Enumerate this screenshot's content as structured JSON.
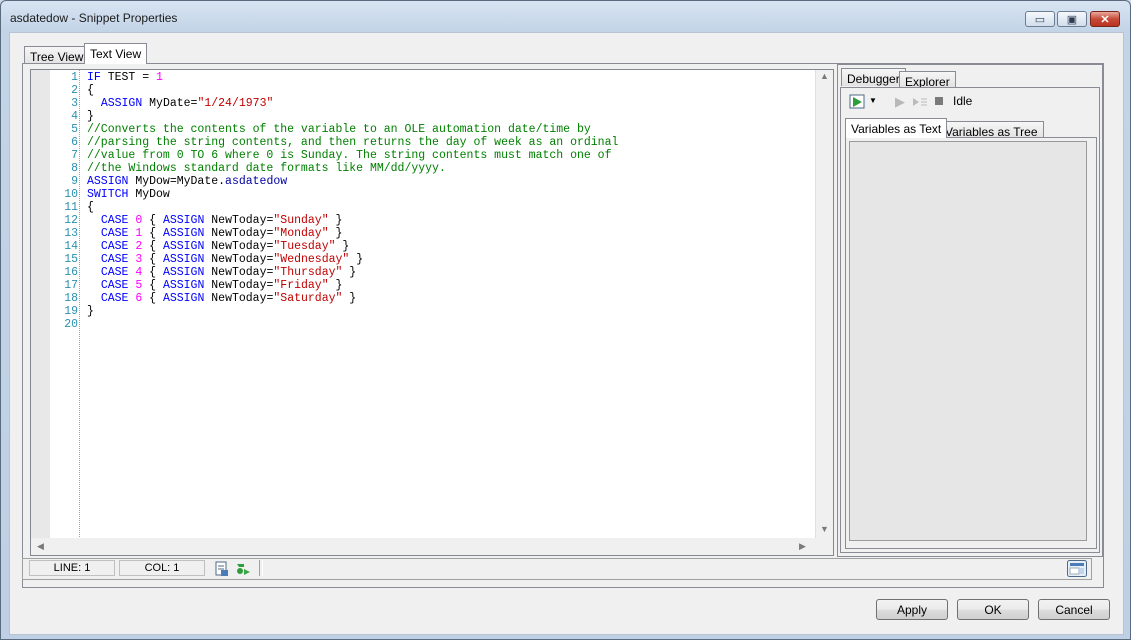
{
  "window": {
    "title": "asdatedow - Snippet Properties",
    "minimize": "▭",
    "maximize": "▣",
    "close": "✕"
  },
  "tabs": [
    {
      "label": "Tree View",
      "active": false
    },
    {
      "label": "Text View",
      "active": true
    }
  ],
  "editor": {
    "line_numbers": [
      "1",
      "2",
      "3",
      "4",
      "5",
      "6",
      "7",
      "8",
      "9",
      "10",
      "11",
      "12",
      "13",
      "14",
      "15",
      "16",
      "17",
      "18",
      "19",
      "20"
    ],
    "lines": [
      [
        {
          "t": "kw",
          "v": "IF"
        },
        {
          "t": "txt",
          "v": " TEST = "
        },
        {
          "t": "num",
          "v": "1"
        }
      ],
      [
        {
          "t": "txt",
          "v": "{"
        }
      ],
      [
        {
          "t": "txt",
          "v": "  "
        },
        {
          "t": "kw",
          "v": "ASSIGN"
        },
        {
          "t": "txt",
          "v": " MyDate="
        },
        {
          "t": "str",
          "v": "\"1/24/1973\""
        }
      ],
      [
        {
          "t": "txt",
          "v": "}"
        }
      ],
      [
        {
          "t": "cm",
          "v": "//Converts the contents of the variable to an OLE automation date/time by"
        }
      ],
      [
        {
          "t": "cm",
          "v": "//parsing the string contents, and then returns the day of week as an ordinal"
        }
      ],
      [
        {
          "t": "cm",
          "v": "//value from 0 TO 6 where 0 is Sunday. The string contents must match one of"
        }
      ],
      [
        {
          "t": "cm",
          "v": "//the Windows standard date formats like MM/dd/yyyy."
        }
      ],
      [
        {
          "t": "kw",
          "v": "ASSIGN"
        },
        {
          "t": "txt",
          "v": " MyDow=MyDate."
        },
        {
          "t": "mem",
          "v": "asdatedow"
        }
      ],
      [
        {
          "t": "kw",
          "v": "SWITCH"
        },
        {
          "t": "txt",
          "v": " MyDow"
        }
      ],
      [
        {
          "t": "txt",
          "v": "{"
        }
      ],
      [
        {
          "t": "txt",
          "v": "  "
        },
        {
          "t": "kw",
          "v": "CASE"
        },
        {
          "t": "txt",
          "v": " "
        },
        {
          "t": "num",
          "v": "0"
        },
        {
          "t": "txt",
          "v": " { "
        },
        {
          "t": "kw",
          "v": "ASSIGN"
        },
        {
          "t": "txt",
          "v": " NewToday="
        },
        {
          "t": "str",
          "v": "\"Sunday\""
        },
        {
          "t": "txt",
          "v": " }"
        }
      ],
      [
        {
          "t": "txt",
          "v": "  "
        },
        {
          "t": "kw",
          "v": "CASE"
        },
        {
          "t": "txt",
          "v": " "
        },
        {
          "t": "num",
          "v": "1"
        },
        {
          "t": "txt",
          "v": " { "
        },
        {
          "t": "kw",
          "v": "ASSIGN"
        },
        {
          "t": "txt",
          "v": " NewToday="
        },
        {
          "t": "str",
          "v": "\"Monday\""
        },
        {
          "t": "txt",
          "v": " }"
        }
      ],
      [
        {
          "t": "txt",
          "v": "  "
        },
        {
          "t": "kw",
          "v": "CASE"
        },
        {
          "t": "txt",
          "v": " "
        },
        {
          "t": "num",
          "v": "2"
        },
        {
          "t": "txt",
          "v": " { "
        },
        {
          "t": "kw",
          "v": "ASSIGN"
        },
        {
          "t": "txt",
          "v": " NewToday="
        },
        {
          "t": "str",
          "v": "\"Tuesday\""
        },
        {
          "t": "txt",
          "v": " }"
        }
      ],
      [
        {
          "t": "txt",
          "v": "  "
        },
        {
          "t": "kw",
          "v": "CASE"
        },
        {
          "t": "txt",
          "v": " "
        },
        {
          "t": "num",
          "v": "3"
        },
        {
          "t": "txt",
          "v": " { "
        },
        {
          "t": "kw",
          "v": "ASSIGN"
        },
        {
          "t": "txt",
          "v": " NewToday="
        },
        {
          "t": "str",
          "v": "\"Wednesday\""
        },
        {
          "t": "txt",
          "v": " }"
        }
      ],
      [
        {
          "t": "txt",
          "v": "  "
        },
        {
          "t": "kw",
          "v": "CASE"
        },
        {
          "t": "txt",
          "v": " "
        },
        {
          "t": "num",
          "v": "4"
        },
        {
          "t": "txt",
          "v": " { "
        },
        {
          "t": "kw",
          "v": "ASSIGN"
        },
        {
          "t": "txt",
          "v": " NewToday="
        },
        {
          "t": "str",
          "v": "\"Thursday\""
        },
        {
          "t": "txt",
          "v": " }"
        }
      ],
      [
        {
          "t": "txt",
          "v": "  "
        },
        {
          "t": "kw",
          "v": "CASE"
        },
        {
          "t": "txt",
          "v": " "
        },
        {
          "t": "num",
          "v": "5"
        },
        {
          "t": "txt",
          "v": " { "
        },
        {
          "t": "kw",
          "v": "ASSIGN"
        },
        {
          "t": "txt",
          "v": " NewToday="
        },
        {
          "t": "str",
          "v": "\"Friday\""
        },
        {
          "t": "txt",
          "v": " }"
        }
      ],
      [
        {
          "t": "txt",
          "v": "  "
        },
        {
          "t": "kw",
          "v": "CASE"
        },
        {
          "t": "txt",
          "v": " "
        },
        {
          "t": "num",
          "v": "6"
        },
        {
          "t": "txt",
          "v": " { "
        },
        {
          "t": "kw",
          "v": "ASSIGN"
        },
        {
          "t": "txt",
          "v": " NewToday="
        },
        {
          "t": "str",
          "v": "\"Saturday\""
        },
        {
          "t": "txt",
          "v": " }"
        }
      ],
      [
        {
          "t": "txt",
          "v": "}"
        }
      ],
      []
    ]
  },
  "status": {
    "line": "LINE: 1",
    "col": "COL: 1"
  },
  "debugger": {
    "tabs": [
      {
        "label": "Debugger",
        "active": true
      },
      {
        "label": "Explorer",
        "active": false
      }
    ],
    "state": "Idle",
    "var_tabs": [
      {
        "label": "Variables as Text",
        "active": true
      },
      {
        "label": "Variables as Tree",
        "active": false
      }
    ]
  },
  "buttons": {
    "apply": "Apply",
    "ok": "OK",
    "cancel": "Cancel"
  },
  "colors": {
    "keyword": "#0000ff",
    "number": "#ff00ff",
    "string": "#c00000",
    "comment": "#008000",
    "line_number": "#2b91af"
  },
  "icons": [
    "run-debug-icon",
    "dropdown-arrow-icon",
    "step-icon",
    "step-into-icon",
    "stop-icon",
    "print-icon",
    "execute-icon",
    "panel-toggle-icon",
    "scroll-up-icon",
    "scroll-down-icon",
    "scroll-left-icon",
    "scroll-right-icon"
  ]
}
